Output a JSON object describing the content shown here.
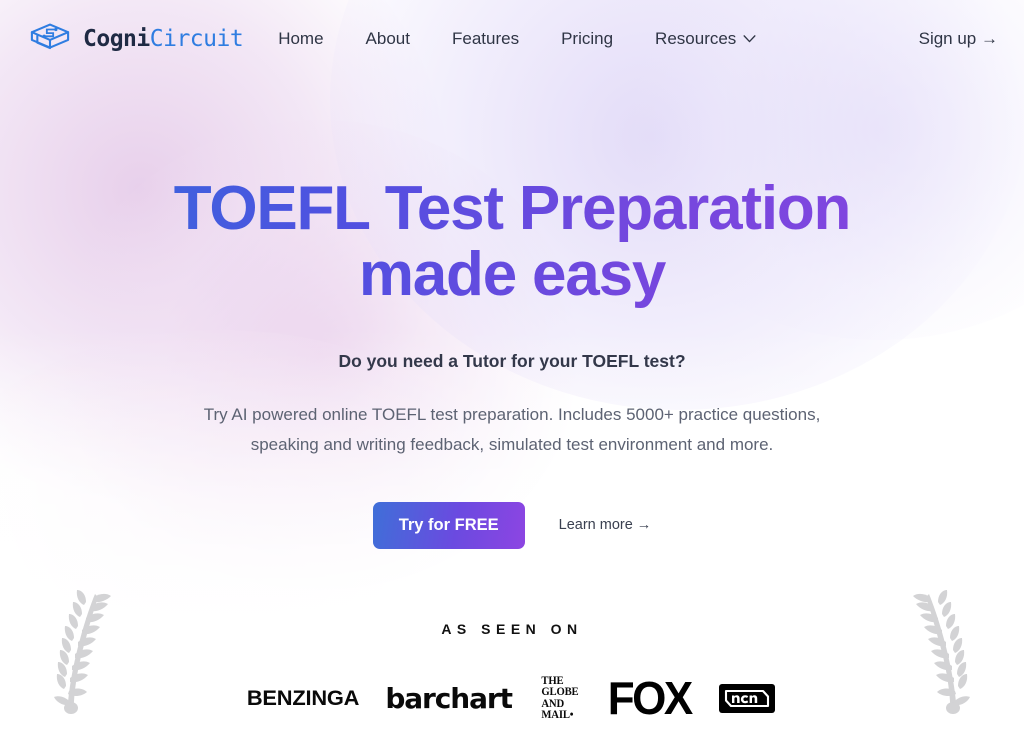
{
  "brand": {
    "icon": "graduation-circuit-icon",
    "name_bold": "Cogni",
    "name_light": "Circuit"
  },
  "nav": {
    "items": [
      {
        "label": "Home",
        "has_caret": false
      },
      {
        "label": "About",
        "has_caret": false
      },
      {
        "label": "Features",
        "has_caret": false
      },
      {
        "label": "Pricing",
        "has_caret": false
      },
      {
        "label": "Resources",
        "has_caret": true
      }
    ],
    "signup_label": "Sign up →"
  },
  "hero": {
    "headline_line1": "TOEFL Test Preparation",
    "headline_line2": "made easy",
    "subheadline": "Do you need a Tutor for your TOEFL test?",
    "lead": "Try AI powered online TOEFL test preparation. Includes 5000+ practice questions, speaking and writing feedback, simulated test environment and more.",
    "primary_cta": "Try for FREE",
    "secondary_cta": "Learn more →"
  },
  "proof": {
    "title": "AS SEEN ON",
    "logos": [
      {
        "name": "benzinga-logo",
        "text": "BENZINGA"
      },
      {
        "name": "barchart-logo",
        "text": "barchart"
      },
      {
        "name": "globe-and-mail-logo",
        "lines": [
          "THE",
          "GLOBE",
          "AND",
          "MAIL•"
        ]
      },
      {
        "name": "fox-logo",
        "text": "FOX"
      },
      {
        "name": "ncn-logo",
        "text": "ncn"
      }
    ],
    "decoration_left": "laurel-branch-left",
    "decoration_right": "laurel-branch-right"
  },
  "colors": {
    "brand_blue": "#2f7de1",
    "brand_navy": "#1f2a44",
    "gradient_start": "#2f6fdc",
    "gradient_end": "#8a46e0",
    "body_text": "#5d6373",
    "page_background": "#ffffff"
  }
}
